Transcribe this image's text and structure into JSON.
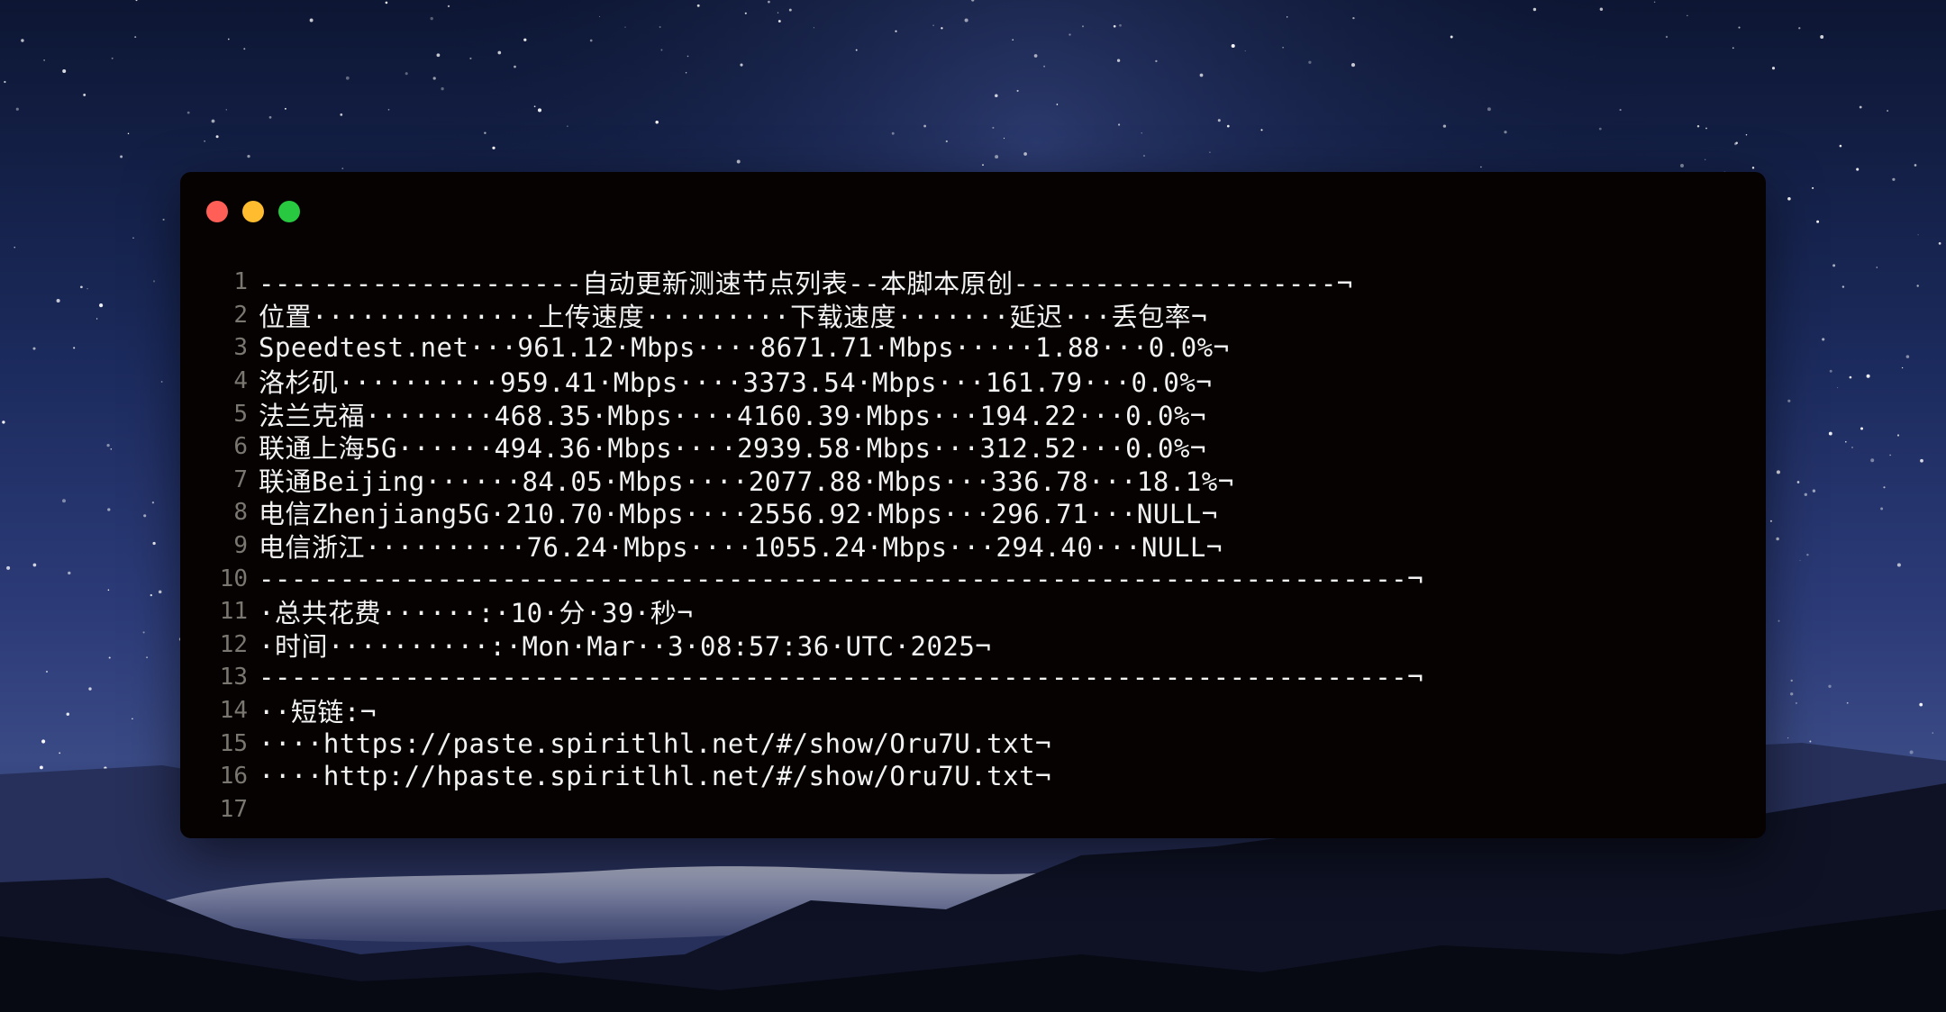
{
  "colors": {
    "window_bg": "#060201",
    "text": "#f2f2f2",
    "line_number": "#7a7670",
    "traffic_red": "#ff5f57",
    "traffic_yellow": "#febc2e",
    "traffic_green": "#28c840"
  },
  "window": {
    "traffic_lights": [
      "close",
      "minimize",
      "zoom"
    ]
  },
  "code": {
    "lines": [
      {
        "n": "1",
        "text": "--------------------自动更新测速节点列表--本脚本原创--------------------¬"
      },
      {
        "n": "2",
        "text": "位置··············上传速度·········下载速度·······延迟···丢包率¬"
      },
      {
        "n": "3",
        "text": "Speedtest.net···961.12·Mbps····8671.71·Mbps·····1.88···0.0%¬"
      },
      {
        "n": "4",
        "text": "洛杉矶··········959.41·Mbps····3373.54·Mbps···161.79···0.0%¬"
      },
      {
        "n": "5",
        "text": "法兰克福········468.35·Mbps····4160.39·Mbps···194.22···0.0%¬"
      },
      {
        "n": "6",
        "text": "联通上海5G······494.36·Mbps····2939.58·Mbps···312.52···0.0%¬"
      },
      {
        "n": "7",
        "text": "联通Beijing······84.05·Mbps····2077.88·Mbps···336.78···18.1%¬"
      },
      {
        "n": "8",
        "text": "电信Zhenjiang5G·210.70·Mbps····2556.92·Mbps···296.71···NULL¬"
      },
      {
        "n": "9",
        "text": "电信浙江··········76.24·Mbps····1055.24·Mbps···294.40···NULL¬"
      },
      {
        "n": "10",
        "text": "-----------------------------------------------------------------------¬"
      },
      {
        "n": "11",
        "text": "·总共花费······:·10·分·39·秒¬"
      },
      {
        "n": "12",
        "text": "·时间··········:·Mon·Mar··3·08:57:36·UTC·2025¬"
      },
      {
        "n": "13",
        "text": "-----------------------------------------------------------------------¬"
      },
      {
        "n": "14",
        "text": "··短链:¬"
      },
      {
        "n": "15",
        "text": "····https://paste.spiritlhl.net/#/show/Oru7U.txt¬"
      },
      {
        "n": "16",
        "text": "····http://hpaste.spiritlhl.net/#/show/Oru7U.txt¬"
      },
      {
        "n": "17",
        "text": ""
      }
    ]
  }
}
